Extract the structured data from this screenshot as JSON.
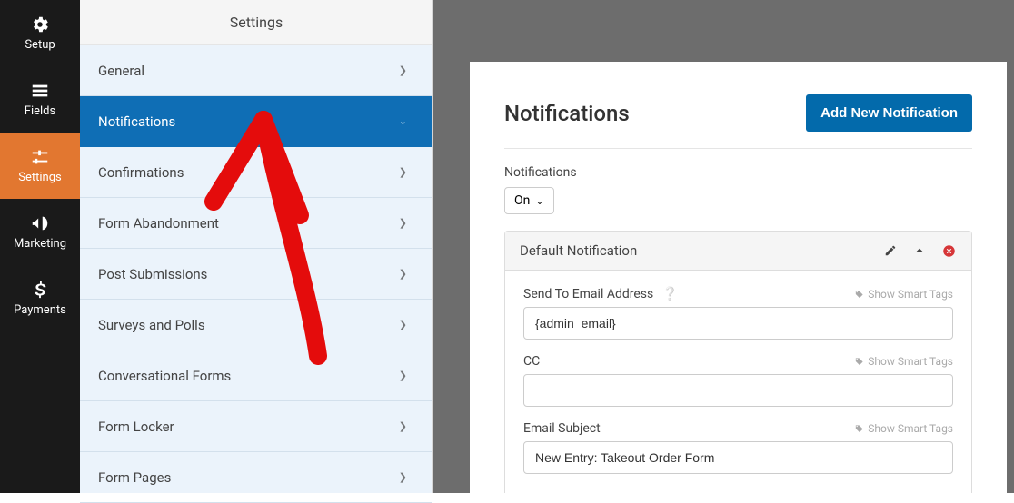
{
  "rail": {
    "items": [
      {
        "label": "Setup"
      },
      {
        "label": "Fields"
      },
      {
        "label": "Settings"
      },
      {
        "label": "Marketing"
      },
      {
        "label": "Payments"
      }
    ]
  },
  "submenu": {
    "title": "Settings",
    "items": [
      {
        "label": "General"
      },
      {
        "label": "Notifications"
      },
      {
        "label": "Confirmations"
      },
      {
        "label": "Form Abandonment"
      },
      {
        "label": "Post Submissions"
      },
      {
        "label": "Surveys and Polls"
      },
      {
        "label": "Conversational Forms"
      },
      {
        "label": "Form Locker"
      },
      {
        "label": "Form Pages"
      }
    ]
  },
  "panel": {
    "title": "Notifications",
    "add_button": "Add New Notification",
    "toggle_label": "Notifications",
    "toggle_value": "On",
    "section_title": "Default Notification",
    "fields": {
      "send_to": {
        "label": "Send To Email Address",
        "value": "{admin_email}"
      },
      "cc": {
        "label": "CC",
        "value": ""
      },
      "subject": {
        "label": "Email Subject",
        "value": "New Entry: Takeout Order Form"
      }
    },
    "smart_tags_label": "Show Smart Tags"
  }
}
